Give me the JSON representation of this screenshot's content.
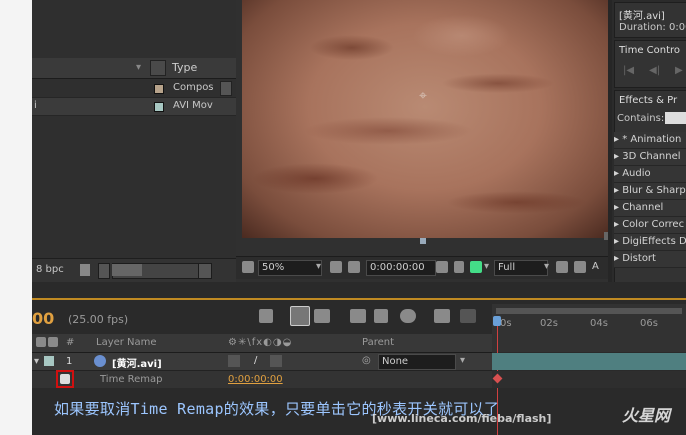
{
  "project": {
    "type_header": "Type",
    "rows": [
      {
        "type": "Compos",
        "color": "#b7a38b"
      },
      {
        "type": "AVI Mov",
        "color": "#a7c7c2"
      }
    ],
    "left_char": "i",
    "bpc": "8 bpc"
  },
  "viewer": {
    "zoom": "50%",
    "timecode": "0:00:00:00",
    "resolution": "Full"
  },
  "right": {
    "footage_name": "[黄河.avi]",
    "duration": "Duration: 0:00",
    "time_control": "Time Contro",
    "effects_title": "Effects & Pr",
    "contains": "Contains:",
    "effects": [
      "* Animation",
      "3D Channel",
      "Audio",
      "Blur & Sharp",
      "Channel",
      "Color Correc",
      "DigiEffects D",
      "Distort"
    ]
  },
  "timeline": {
    "time_partial": "00",
    "fps": "(25.00 fps)",
    "col_num": "#",
    "col_layer": "Layer Name",
    "col_parent": "Parent",
    "ruler_labels": [
      "0s",
      "02s",
      "04s",
      "06s"
    ],
    "layer_num": "1",
    "layer_name": "[黄河.avi]",
    "parent_value": "None",
    "prop_name": "Time Remap",
    "prop_value": "0:00:00:00"
  },
  "caption": "如果要取消Time Remap的效果，只要单击它的秒表开关就可以了",
  "watermark": "[www.lineca.com/fieba/flash]",
  "logo_text": "火星网"
}
